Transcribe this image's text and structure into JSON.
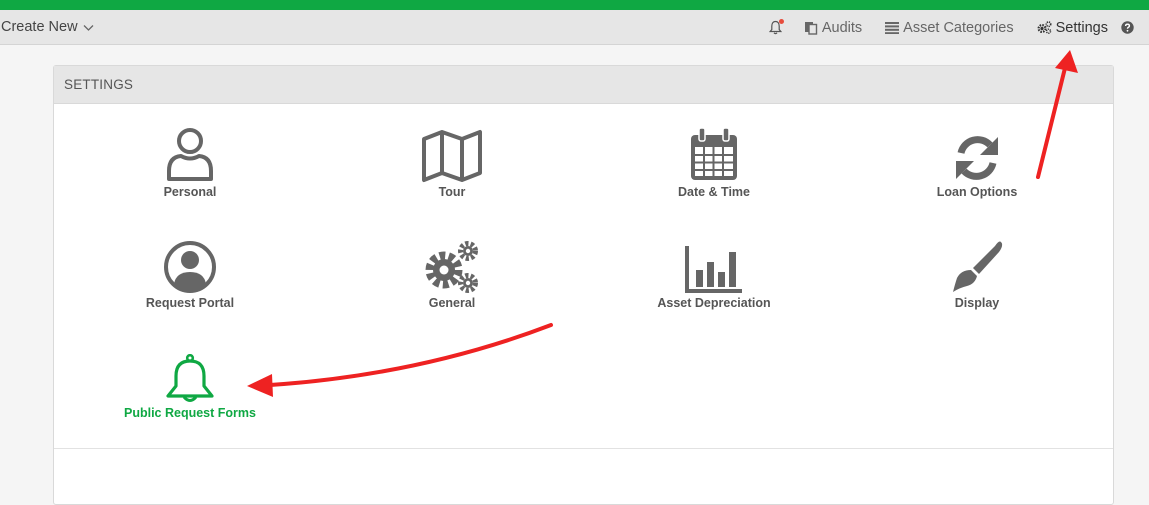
{
  "navbar": {
    "create_new": "Create New",
    "items": [
      {
        "label": "Audits"
      },
      {
        "label": "Asset Categories"
      },
      {
        "label": "Settings"
      }
    ]
  },
  "settings": {
    "title": "SETTINGS",
    "tiles": [
      {
        "label": "Personal",
        "icon": "person-icon"
      },
      {
        "label": "Tour",
        "icon": "map-icon"
      },
      {
        "label": "Date & Time",
        "icon": "calendar-icon"
      },
      {
        "label": "Loan Options",
        "icon": "refresh-icon"
      },
      {
        "label": "Request Portal",
        "icon": "user-circle-icon"
      },
      {
        "label": "General",
        "icon": "cogs-icon"
      },
      {
        "label": "Asset Depreciation",
        "icon": "bar-chart-icon"
      },
      {
        "label": "Display",
        "icon": "paintbrush-icon"
      },
      {
        "label": "Public Request Forms",
        "icon": "bell-icon"
      }
    ]
  },
  "colors": {
    "accent_green": "#0fa843",
    "icon_gray": "#666666",
    "annotation_red": "#ee2222"
  }
}
